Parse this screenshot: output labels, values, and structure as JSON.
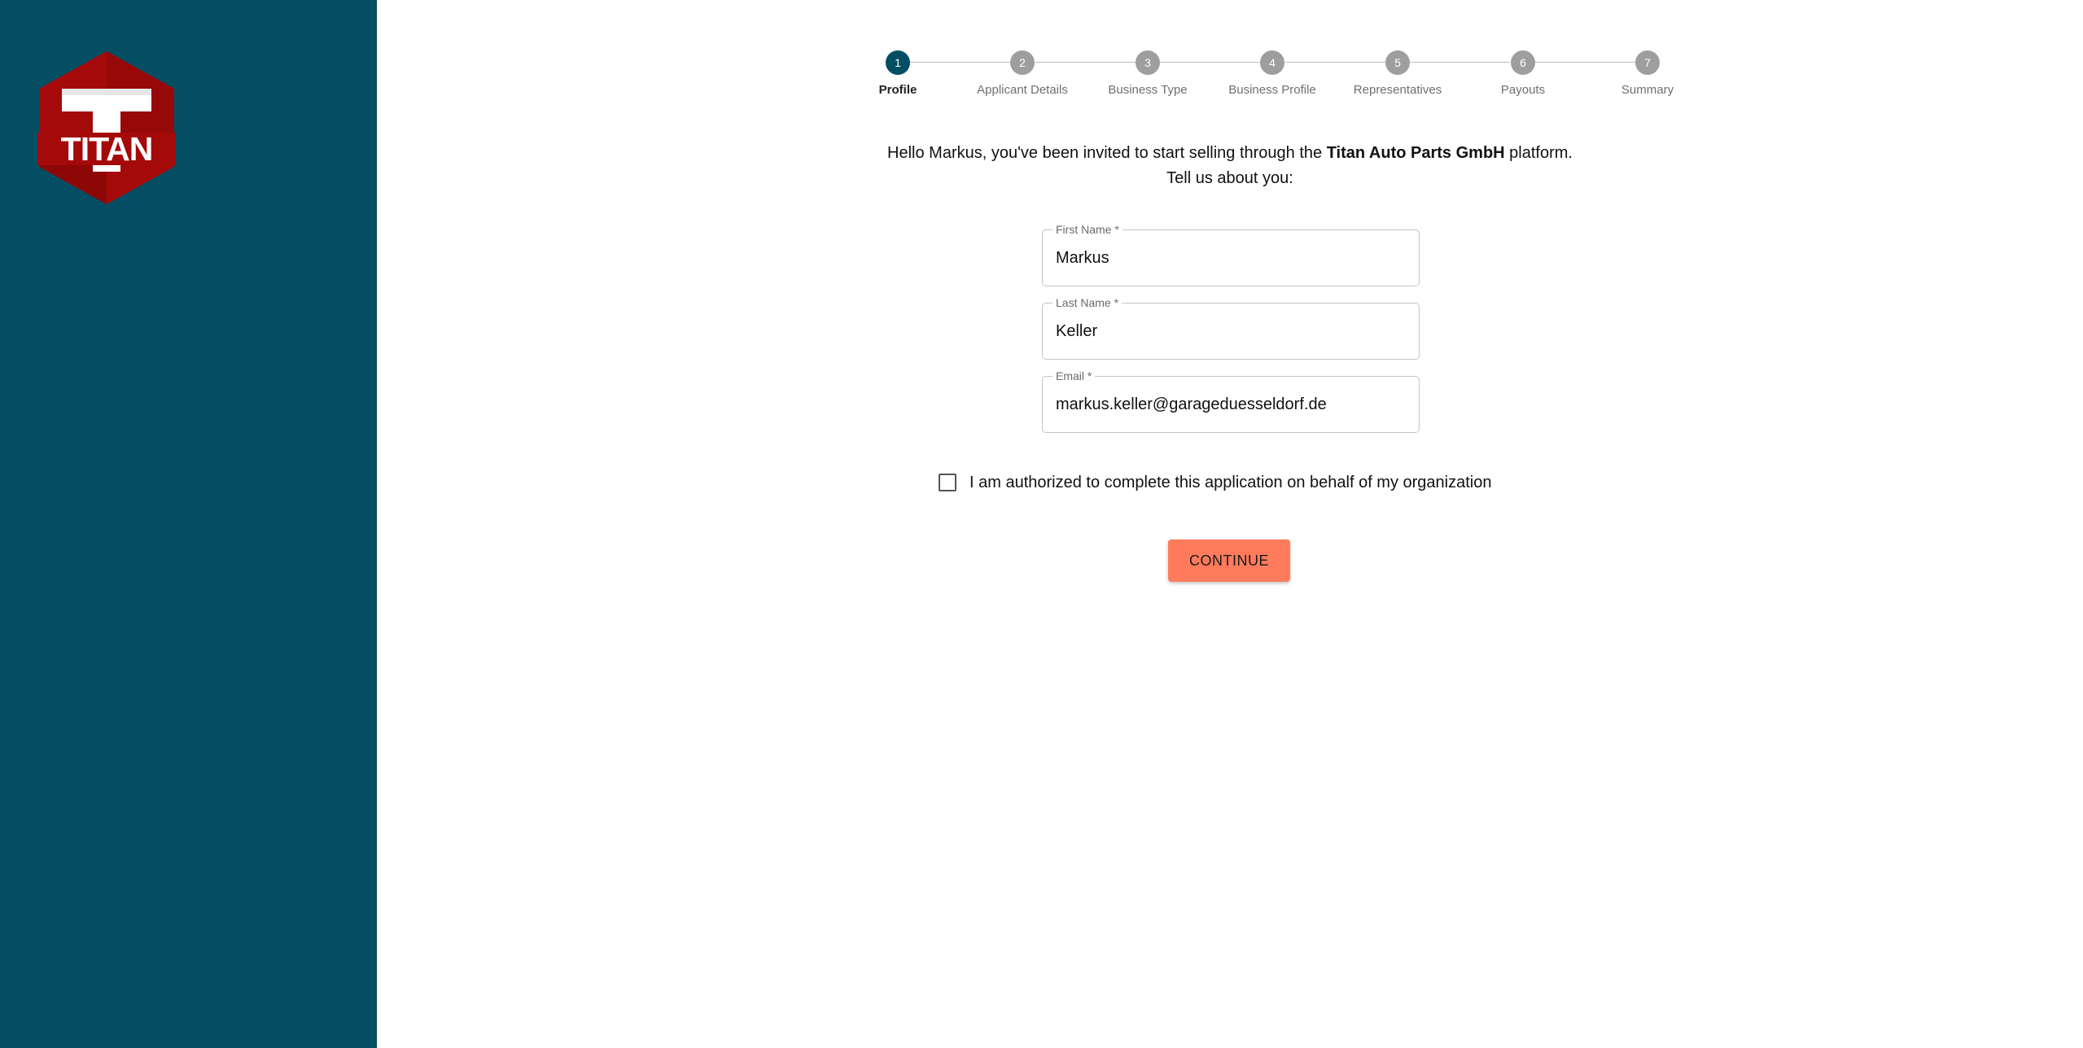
{
  "brand": {
    "logo_text": "TITAN",
    "sidebar_color": "#044e63",
    "logo_red": "#a40a0a",
    "logo_dark_red": "#7c0606",
    "accent_button": "#ff7b5c"
  },
  "stepper": {
    "steps": [
      {
        "number": "1",
        "label": "Profile",
        "active": true
      },
      {
        "number": "2",
        "label": "Applicant Details",
        "active": false
      },
      {
        "number": "3",
        "label": "Business Type",
        "active": false
      },
      {
        "number": "4",
        "label": "Business Profile",
        "active": false
      },
      {
        "number": "5",
        "label": "Representatives",
        "active": false
      },
      {
        "number": "6",
        "label": "Payouts",
        "active": false
      },
      {
        "number": "7",
        "label": "Summary",
        "active": false
      }
    ]
  },
  "intro": {
    "line1_prefix": "Hello Markus, you've been invited to start selling through the ",
    "company": "Titan Auto Parts GmbH",
    "line1_suffix": " platform.",
    "line2": "Tell us about you:"
  },
  "form": {
    "first_name": {
      "label": "First Name *",
      "value": "Markus"
    },
    "last_name": {
      "label": "Last Name *",
      "value": "Keller"
    },
    "email": {
      "label": "Email *",
      "value": "markus.keller@garageduesseldorf.de"
    },
    "authorized_label": "I am authorized to complete this application on behalf of my organization",
    "authorized_checked": false,
    "continue_label": "CONTINUE"
  }
}
